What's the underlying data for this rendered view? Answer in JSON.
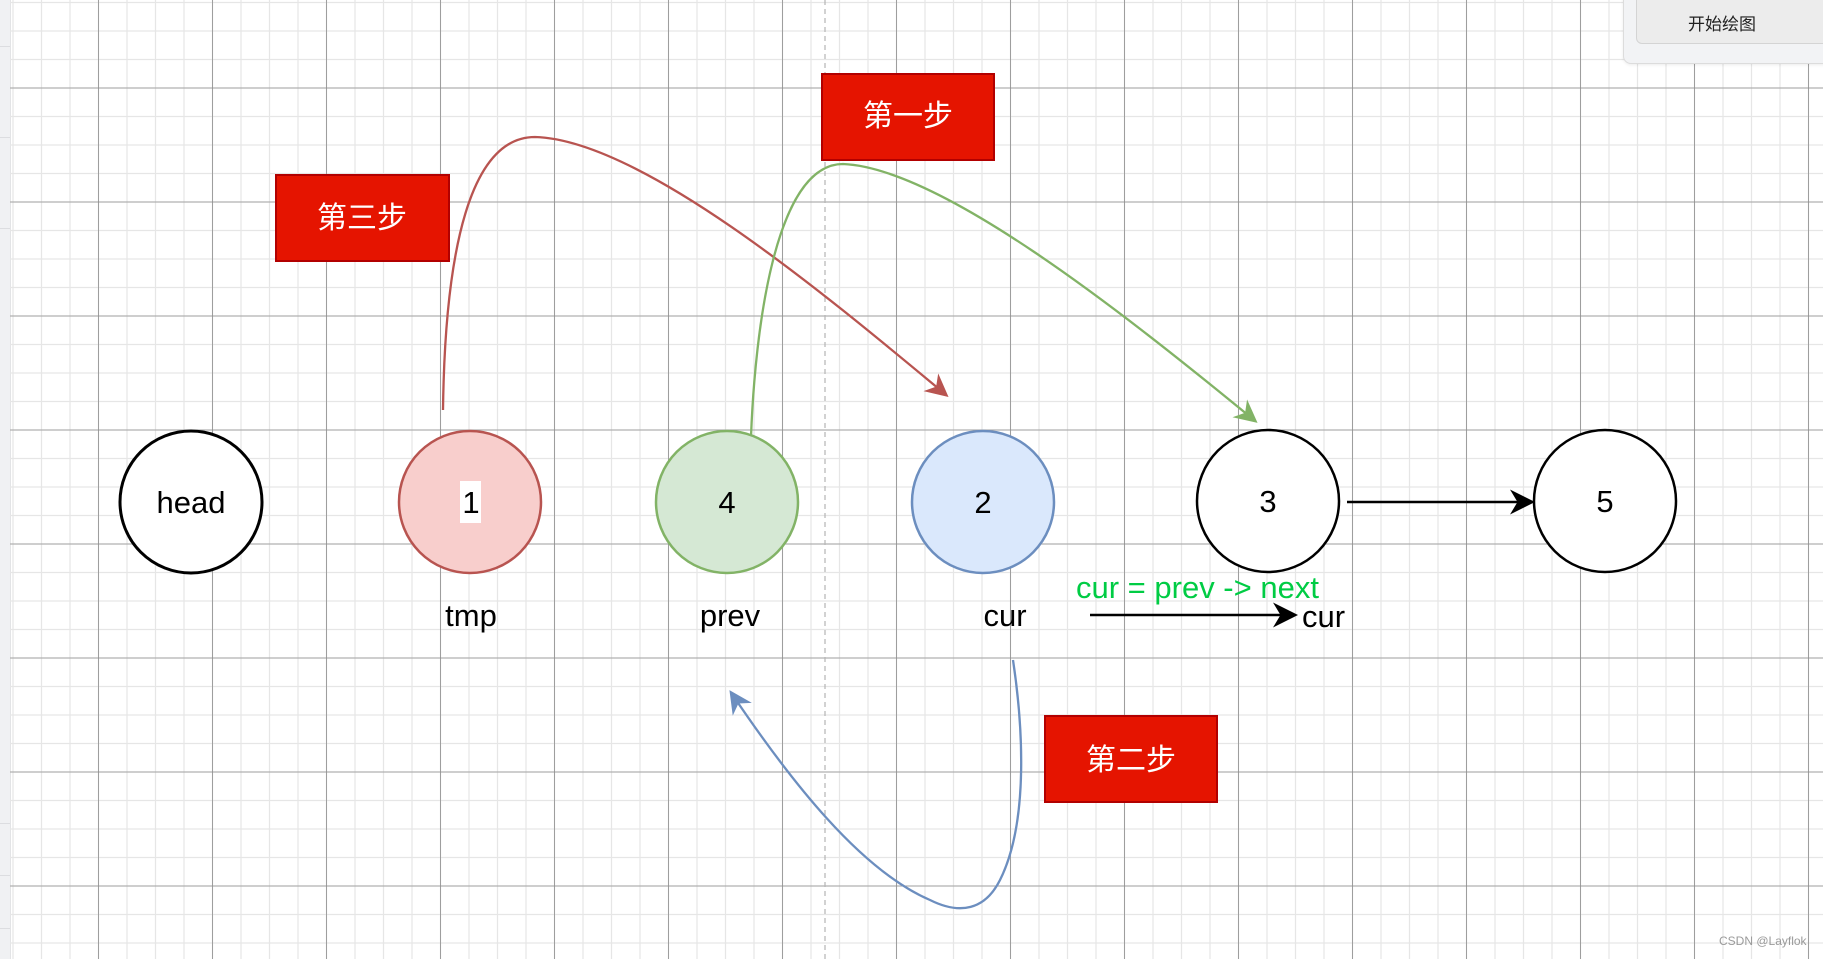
{
  "app": {
    "start_drawing_button": "开始绘图",
    "watermark": "CSDN @Layflok"
  },
  "colors": {
    "grid_minor": "#e6e6e6",
    "grid_major": "#8c8c8c",
    "step_box_fill": "#e51400",
    "step_box_stroke": "#b20000",
    "red_arrow": "#b85450",
    "green_arrow": "#82b366",
    "blue_arrow": "#6c8ebf",
    "annotation_green": "#00cc44"
  },
  "nodes": [
    {
      "id": "head",
      "label": "head",
      "fill": "#ffffff",
      "stroke": "#000000",
      "caption": ""
    },
    {
      "id": "n1",
      "label": "1",
      "fill": "#f8cecc",
      "stroke": "#b85450",
      "caption": "tmp"
    },
    {
      "id": "n4",
      "label": "4",
      "fill": "#d5e8d4",
      "stroke": "#82b366",
      "caption": "prev"
    },
    {
      "id": "n2",
      "label": "2",
      "fill": "#dae8fc",
      "stroke": "#6c8ebf",
      "caption": "cur"
    },
    {
      "id": "n3",
      "label": "3",
      "fill": "#ffffff",
      "stroke": "#000000",
      "caption": ""
    },
    {
      "id": "n5",
      "label": "5",
      "fill": "#ffffff",
      "stroke": "#000000",
      "caption": ""
    }
  ],
  "steps": [
    {
      "id": "step1",
      "label": "第一步",
      "arrow": "green",
      "from": "n4",
      "to": "n3"
    },
    {
      "id": "step2",
      "label": "第二步",
      "arrow": "blue",
      "from": "cur-label",
      "to": "prev-label"
    },
    {
      "id": "step3",
      "label": "第三步",
      "arrow": "red",
      "from": "n1",
      "to": "n2"
    }
  ],
  "edges": [
    {
      "from": "n3",
      "to": "n5"
    }
  ],
  "annotation": {
    "expression": "cur = prev -> next",
    "moved_label": "cur"
  }
}
